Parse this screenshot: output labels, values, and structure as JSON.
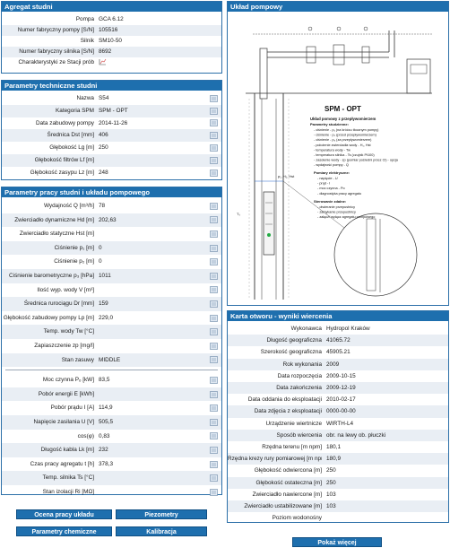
{
  "agregat": {
    "title": "Agregat studni",
    "rows": [
      {
        "label": "Pompa",
        "value": "GCA 6.12"
      },
      {
        "label": "Numer fabryczny pompy [S/N]",
        "value": "105516"
      },
      {
        "label": "Silnik",
        "value": "SM10-50"
      },
      {
        "label": "Numer fabryczny silnika [S/N]",
        "value": "8692"
      },
      {
        "label": "Charakterystyki ze Stacji prób",
        "value": ""
      }
    ]
  },
  "parametry_techniczne": {
    "title": "Parametry techniczne studni",
    "rows": [
      {
        "label": "Nazwa",
        "value": "S54"
      },
      {
        "label": "Kategoria SPM",
        "value": "SPM - OPT"
      },
      {
        "label": "Data zabudowy pompy",
        "value": "2014-11-26"
      },
      {
        "label": "Średnica Dst [mm]",
        "value": "406"
      },
      {
        "label": "Głębokość Lg [m]",
        "value": "250"
      },
      {
        "label": "Głębokość filtrów Lf [m]",
        "value": ""
      },
      {
        "label": "Głębokość zasypu Lz [m]",
        "value": "248"
      }
    ]
  },
  "parametry_pracy": {
    "title": "Parametry pracy studni i układu pompowego",
    "rows_a": [
      {
        "label": "Wydajność Q [m³/h]",
        "value": "78"
      },
      {
        "label": "Zwierciadło dynamiczne Hd [m]",
        "value": "202,63"
      },
      {
        "label": "Zwierciadło statyczne Hst [m]",
        "value": ""
      },
      {
        "label": "Ciśnienie p₁ [m]",
        "value": "0"
      },
      {
        "label": "Ciśnienie p₂ [m]",
        "value": "0"
      },
      {
        "label": "Ciśnienie barometryczne p₃ [hPa]",
        "value": "1011"
      },
      {
        "label": "Ilość wyp. wody V [m³]",
        "value": ""
      },
      {
        "label": "Średnica rurociągu Dr [mm]",
        "value": "159"
      },
      {
        "label": "Głębokość zabudowy pompy Lp [m]",
        "value": "229,0"
      },
      {
        "label": "Temp. wody Tw [°C]",
        "value": ""
      },
      {
        "label": "Zapiaszczenie zp [mg/l]",
        "value": ""
      },
      {
        "label": "Stan zasuwy",
        "value": "MIDDLE"
      }
    ],
    "rows_b": [
      {
        "label": "Moc czynna Pₒ [kW]",
        "value": "83,5"
      },
      {
        "label": "Pobór energii E [kWh]",
        "value": ""
      },
      {
        "label": "Pobór prądu I [A]",
        "value": "114,9"
      },
      {
        "label": "Napięcie zasilania U [V]",
        "value": "505,5"
      },
      {
        "label": "cos(φ)",
        "value": "0,83"
      },
      {
        "label": "Długość kabla Lk [m]",
        "value": "232"
      },
      {
        "label": "Czas pracy agregatu t [h]",
        "value": "378,3"
      },
      {
        "label": "Temp. silnika Ts [°C]",
        "value": ""
      },
      {
        "label": "Stan izolacji Ri [MΩ]",
        "value": ""
      }
    ]
  },
  "uklad": {
    "title": "Układ pompowy",
    "drawing_title": "SPM - OPT",
    "legend_head": "Układ pomowy z przepływomierzem",
    "legend_sub": "Parametry studzienne:",
    "legend_items": [
      "- ciśnienie - p₁ (na króćcu tłocznym pompy)",
      "- ciśnienie - p₂ (przed przepływomierzem)",
      "- ciśnienie - p₃ (za przepływomierzem)",
      "- położenie zwierciadła wody - H₁, Hst",
      "- temperatura wody - Tw",
      "- temperatura silnika - Ts (czujnik Pt100)",
      "- zasolenie wody - zp (pomiar pośredni przez Cl) - opcja",
      "- wydajność pompy - Q"
    ],
    "pomiary_head": "Pomiary elektryczne:",
    "pomiary_items": [
      "- napięcie - U",
      "- prąd - I",
      "- moc czynna - Po",
      "- diagnostyka pracy agregatu"
    ],
    "sterowanie_head": "Sterowanie zdalne:",
    "sterowanie_items": [
      "- otwieranie przepustnicy",
      "- zamykanie przepustnicy",
      "- załącz/ wyłącz agregatu pompowego"
    ],
    "label_p": "p₁, H₁, Hst",
    "label_t": "Tₛ"
  },
  "karta": {
    "title": "Karta otworu - wyniki wiercenia",
    "rows": [
      {
        "label": "Wykonawca",
        "value": "Hydropol Kraków"
      },
      {
        "label": "Długość geograficzna",
        "value": "41065.72"
      },
      {
        "label": "Szerokość geograficzna",
        "value": "45905.21"
      },
      {
        "label": "Rok wykonania",
        "value": "2009"
      },
      {
        "label": "Data rozpoczęcia",
        "value": "2009-10-15"
      },
      {
        "label": "Data zakończenia",
        "value": "2009-12-19"
      },
      {
        "label": "Data oddania do eksploatacji",
        "value": "2010-02-17"
      },
      {
        "label": "Data zdjęcia z eksploatacji",
        "value": "0000-00-00"
      },
      {
        "label": "Urządzenie wiertnicze",
        "value": "WIRTH-L4"
      },
      {
        "label": "Sposób wiercenia",
        "value": "obr. na lewy ob. płuczki"
      },
      {
        "label": "Rzędna terenu [m npm]",
        "value": "180,1"
      },
      {
        "label": "Rzędna krezy rury pomiarowej [m npm]",
        "value": "180,9"
      },
      {
        "label": "Głębokość odwiercona [m]",
        "value": "250"
      },
      {
        "label": "Głębokość ostateczna [m]",
        "value": "250"
      },
      {
        "label": "Zwierciadło nawiercone [m]",
        "value": "103"
      },
      {
        "label": "Zwierciadło ustabilizowane [m]",
        "value": "103"
      },
      {
        "label": "Poziom wodonośny",
        "value": ""
      }
    ]
  },
  "buttons": {
    "ocena": "Ocena pracy układu",
    "piezometry": "Piezometry",
    "chemiczne": "Parametry chemiczne",
    "kalibracja": "Kalibracja",
    "pokaz": "Pokaż więcej"
  },
  "colors": {
    "header": "#1e6fae",
    "border": "#2b6fa8",
    "shade": "#e9eef4"
  }
}
